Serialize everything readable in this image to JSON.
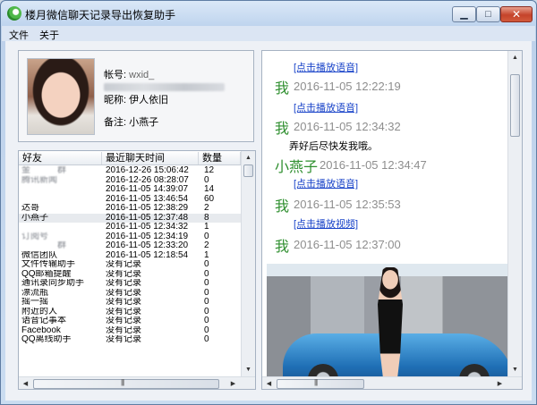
{
  "window": {
    "title": "楼月微信聊天记录导出恢复助手",
    "minimize_glyph": "▁",
    "maximize_glyph": "□",
    "close_glyph": "✕"
  },
  "menu": [
    "文件",
    "关于"
  ],
  "profile": {
    "id_label": "帐号:",
    "id_value": "wxid_",
    "nickname_label": "昵称:",
    "nickname_value": "伊人依旧",
    "remark_label": "备注:",
    "remark_value": "小燕子"
  },
  "friends_table": {
    "headers": [
      "好友",
      "最近聊天时间",
      "数量"
    ],
    "rows": [
      {
        "name": "金　　　群",
        "time": "2016-12-26 15:06:42",
        "count": "12",
        "obscured": true
      },
      {
        "name": "腾讯新闻",
        "time": "2016-12-26 08:28:07",
        "count": "0",
        "obscured": true
      },
      {
        "name": "　　",
        "time": "2016-11-05 14:39:07",
        "count": "14",
        "obscured": true
      },
      {
        "name": "　　",
        "time": "2016-11-05 13:46:54",
        "count": "60",
        "obscured": true
      },
      {
        "name": "达哥",
        "time": "2016-11-05 12:38:29",
        "count": "2",
        "obscured": false
      },
      {
        "name": "小燕子",
        "time": "2016-11-05 12:37:48",
        "count": "8",
        "obscured": false,
        "selected": true
      },
      {
        "name": "　　",
        "time": "2016-11-05 12:34:32",
        "count": "1",
        "obscured": true
      },
      {
        "name": "订阅号",
        "time": "2016-11-05 12:34:19",
        "count": "0",
        "obscured": true
      },
      {
        "name": "　　　　群",
        "time": "2016-11-05 12:33:20",
        "count": "2",
        "obscured": true
      },
      {
        "name": "微信团队",
        "time": "2016-11-05 12:18:54",
        "count": "1",
        "obscured": false
      },
      {
        "name": "文件传输助手",
        "time": "没有记录",
        "count": "0",
        "obscured": false
      },
      {
        "name": "QQ邮箱提醒",
        "time": "没有记录",
        "count": "0",
        "obscured": false
      },
      {
        "name": "通讯录同步助手",
        "time": "没有记录",
        "count": "0",
        "obscured": false
      },
      {
        "name": "漂流瓶",
        "time": "没有记录",
        "count": "0",
        "obscured": false
      },
      {
        "name": "摇一摇",
        "time": "没有记录",
        "count": "0",
        "obscured": false
      },
      {
        "name": "附近的人",
        "time": "没有记录",
        "count": "0",
        "obscured": false
      },
      {
        "name": "语音记事本",
        "time": "没有记录",
        "count": "0",
        "obscured": false
      },
      {
        "name": "Facebook",
        "time": "没有记录",
        "count": "0",
        "obscured": false
      },
      {
        "name": "QQ离线助手",
        "time": "没有记录",
        "count": "0",
        "obscured": false
      }
    ]
  },
  "chat": {
    "messages": [
      {
        "type": "link",
        "text": "[点击播放语音]"
      },
      {
        "type": "header",
        "sender": "我",
        "time": "2016-11-05 12:22:19"
      },
      {
        "type": "link",
        "text": "[点击播放语音]"
      },
      {
        "type": "header",
        "sender": "我",
        "time": "2016-11-05 12:34:32"
      },
      {
        "type": "text",
        "text": "弄好后尽快发我哦。"
      },
      {
        "type": "header",
        "sender": "小燕子",
        "time": "2016-11-05 12:34:47"
      },
      {
        "type": "link",
        "text": "[点击播放语音]"
      },
      {
        "type": "header",
        "sender": "我",
        "time": "2016-11-05 12:35:53"
      },
      {
        "type": "link",
        "text": "[点击播放视频]"
      },
      {
        "type": "header",
        "sender": "我",
        "time": "2016-11-05 12:37:00"
      }
    ]
  },
  "scroll": {
    "up_glyph": "▲",
    "down_glyph": "▼",
    "left_glyph": "◀",
    "right_glyph": "▶",
    "grip_glyph": "|||"
  },
  "colors": {
    "link": "#1a44c9",
    "sender": "#2f8f2f",
    "timestamp": "#8e8e8e",
    "selected_row": "#e7eaee"
  }
}
